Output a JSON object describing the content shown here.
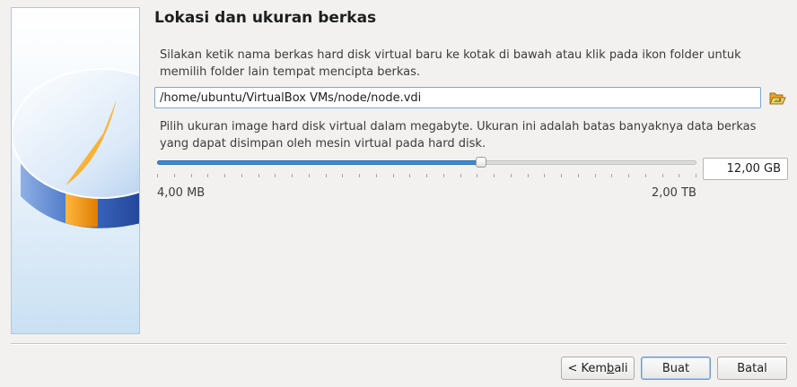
{
  "page": {
    "title": "Lokasi dan ukuran berkas",
    "location_description": "Silakan ketik nama berkas hard disk virtual baru ke kotak di bawah atau klik pada ikon folder untuk\nmemilih folder lain tempat mencipta berkas.",
    "size_description": "Pilih ukuran image hard disk virtual dalam megabyte. Ukuran ini adalah batas banyaknya data berkas\nyang dapat disimpan oleh mesin virtual pada hard disk."
  },
  "location": {
    "path_value": "/home/ubuntu/VirtualBox VMs/node/node.vdi",
    "folder_icon": "folder-open-icon"
  },
  "size": {
    "value_text": "12,00 GB",
    "min_label": "4,00 MB",
    "max_label": "2,00 TB",
    "slider_position": 0.6,
    "tick_count": 33
  },
  "buttons": {
    "back_prefix": "< Kem",
    "back_mnemonic": "b",
    "back_suffix": "ali",
    "create_label": "Buat",
    "cancel_label": "Batal"
  },
  "colors": {
    "accent": "#3b8ad6",
    "pie_blue": "#4a78c8",
    "pie_orange": "#f7a31c"
  }
}
